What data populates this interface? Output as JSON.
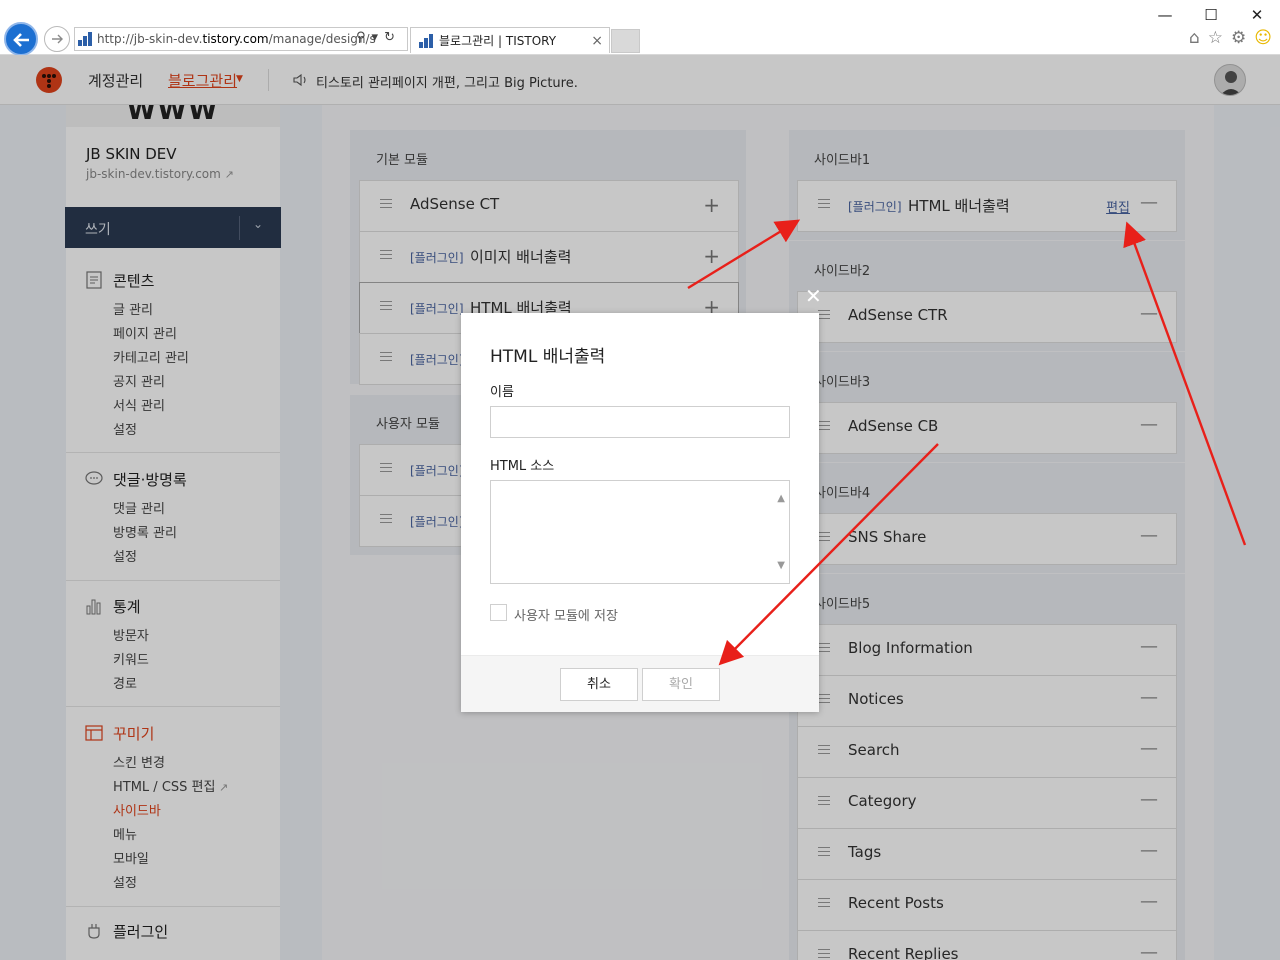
{
  "browser": {
    "url_prefix": "http://jb-skin-dev.",
    "url_domain": "tistory.com",
    "url_rest": "/manage/design/s",
    "tab_title": "블로그관리 | TISTORY",
    "window_controls": {
      "minimize": "—",
      "maximize": "☐",
      "close": "✕"
    },
    "tab_close": "×"
  },
  "topbar": {
    "account_label": "계정관리",
    "blog_manage_label": "블로그관리",
    "notice_text": "티스토리 관리페이지 개편, 그리고 Big Picture."
  },
  "sidebar": {
    "blog_name": "JB SKIN DEV",
    "blog_url": "jb-skin-dev.tistory.com",
    "cover_text": "WWW",
    "write_label": "쓰기",
    "sections": [
      {
        "title": "콘텐츠",
        "items": [
          "글 관리",
          "페이지 관리",
          "카테고리 관리",
          "공지 관리",
          "서식 관리",
          "설정"
        ]
      },
      {
        "title": "댓글·방명록",
        "items": [
          "댓글 관리",
          "방명록 관리",
          "설정"
        ]
      },
      {
        "title": "통계",
        "items": [
          "방문자",
          "키워드",
          "경로"
        ]
      },
      {
        "title": "꾸미기",
        "items": [
          "스킨 변경",
          "HTML / CSS 편집",
          "사이드바",
          "메뉴",
          "모바일",
          "설정"
        ]
      },
      {
        "title": "플러그인",
        "items": []
      }
    ]
  },
  "left_panel": {
    "basic_title": "기본 모듈",
    "basic_modules": [
      {
        "tag": "",
        "name": "AdSense CT"
      },
      {
        "tag": "[플러그인]",
        "name": "이미지 배너출력"
      },
      {
        "tag": "[플러그인]",
        "name": "HTML 배너출력"
      },
      {
        "tag": "[플러그인]",
        "name": ""
      }
    ],
    "user_title": "사용자 모듈",
    "user_modules": [
      {
        "tag": "[플러그인]",
        "name": ""
      },
      {
        "tag": "[플러그인]",
        "name": ""
      }
    ]
  },
  "right_panel": {
    "sidebars": [
      {
        "title": "사이드바1",
        "modules": [
          {
            "tag": "[플러그인]",
            "name": "HTML 배너출력",
            "edit": "편집"
          }
        ]
      },
      {
        "title": "사이드바2",
        "modules": [
          {
            "name": "AdSense CTR"
          }
        ]
      },
      {
        "title": "사이드바3",
        "modules": [
          {
            "name": "AdSense CB"
          }
        ]
      },
      {
        "title": "사이드바4",
        "modules": [
          {
            "name": "SNS Share"
          }
        ]
      },
      {
        "title": "사이드바5",
        "modules": [
          {
            "name": "Blog Information"
          },
          {
            "name": "Notices"
          },
          {
            "name": "Search"
          },
          {
            "name": "Category"
          },
          {
            "name": "Tags"
          },
          {
            "name": "Recent Posts"
          },
          {
            "name": "Recent Replies"
          }
        ]
      }
    ]
  },
  "dialog": {
    "title": "HTML 배너출력",
    "name_label": "이름",
    "name_value": "",
    "source_label": "HTML 소스",
    "source_value": "",
    "save_checkbox_label": "사용자 모듈에 저장",
    "cancel_label": "취소",
    "ok_label": "확인",
    "close_symbol": "✕"
  },
  "colors": {
    "accent": "#e0431c",
    "navy": "#2b3a52",
    "link": "#4863a0",
    "arrow": "#e8201a"
  },
  "icons": [
    "back-arrow-icon",
    "forward-arrow-icon",
    "search-icon",
    "refresh-icon",
    "home-icon",
    "star-icon",
    "gear-icon",
    "smiley-icon",
    "speaker-icon",
    "external-link-icon",
    "chevron-down-icon",
    "plus-icon",
    "minus-icon",
    "close-icon"
  ]
}
